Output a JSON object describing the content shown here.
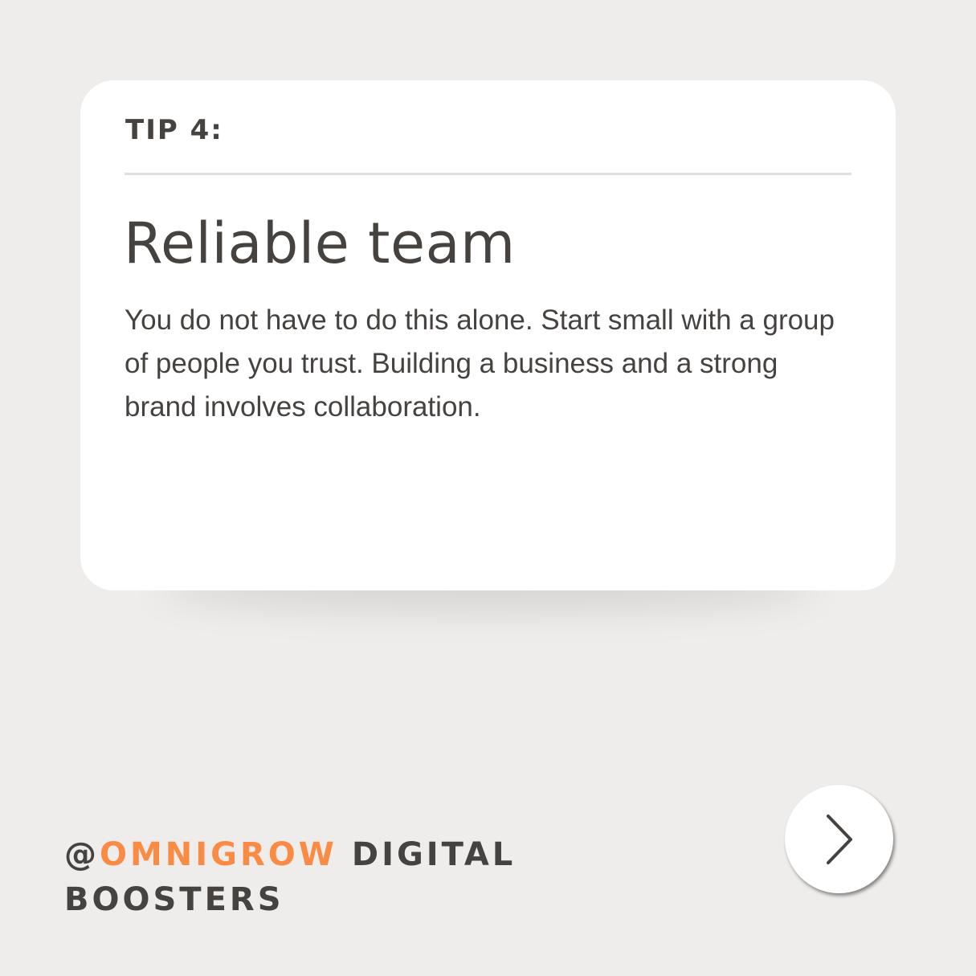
{
  "card": {
    "tip_label": "TIP 4:",
    "title": "Reliable team",
    "body": "You do not have to do this alone. Start small with a group of people you trust. Building a business and a strong brand involves collaboration."
  },
  "footer": {
    "at_sign": "@",
    "brand_accent": "OMNIGROW",
    "brand_rest": " DIGITAL",
    "brand_line2": "BOOSTERS"
  },
  "navigation": {
    "next_icon": "chevron-right-icon"
  },
  "colors": {
    "background": "#eeedeb",
    "card": "#ffffff",
    "text": "#45423f",
    "accent": "#f98b45"
  }
}
